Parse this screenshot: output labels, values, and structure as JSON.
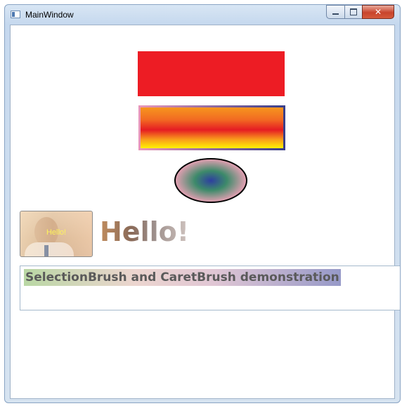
{
  "window": {
    "title": "MainWindow",
    "controls": {
      "minimize": "minimize-icon",
      "maximize": "maximize-icon",
      "close": "close-icon"
    }
  },
  "content": {
    "red_rectangle": {
      "fill": "#ed1c24"
    },
    "gradient_rectangle": {
      "fill_stops": [
        "#f6951e",
        "#e51c23",
        "#fff200"
      ],
      "stroke_stops": [
        "#e896b8",
        "#3a3f8a"
      ]
    },
    "ellipse": {
      "fill_stops": [
        "#2e3fa0",
        "#3d8a6a",
        "#e8a0b4"
      ],
      "stroke": "#000000"
    },
    "image_button": {
      "label": "Hello!",
      "label_color": "#fff45a"
    },
    "hello_text": "Hello!",
    "textbox": {
      "text": "SelectionBrush and CaretBrush demonstration",
      "selection_brush_stops": [
        "#b9d7a4",
        "#ecd5cf",
        "#9699c8"
      ]
    }
  }
}
